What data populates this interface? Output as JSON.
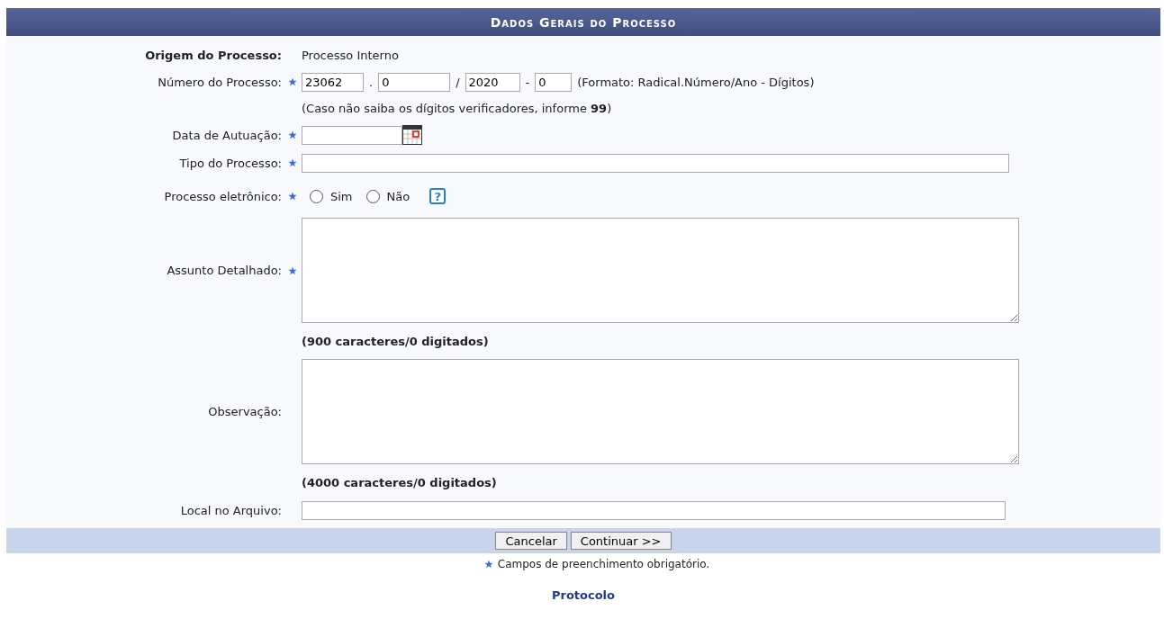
{
  "header": {
    "title": "Dados Gerais do Processo"
  },
  "fields": [
    {
      "kind": "static",
      "label": "Origem do Processo:",
      "required": false,
      "value": "Processo Interno"
    },
    {
      "kind": "process_number",
      "label": "Número do Processo:",
      "required": true,
      "parts": [
        {
          "value": "23062"
        },
        {
          "separator": ".",
          "value": "0"
        },
        {
          "separator": "/",
          "value": "2020"
        },
        {
          "separator": "-",
          "value": "0"
        }
      ],
      "format": "(Formato: Radical.Número/Ano - Dígitos)"
    },
    {
      "kind": "note",
      "text": "(Caso não saiba os dígitos verificadores, informe **99**)"
    },
    {
      "kind": "date",
      "label": "Data de Autuação:",
      "required": true
    },
    {
      "kind": "text",
      "label": "Tipo do Processo:",
      "required": true
    },
    {
      "kind": "radio",
      "label": "Processo eletrônico:",
      "required": true,
      "options": [
        {
          "label": "Sim",
          "selected": false
        },
        {
          "label": "Não",
          "selected": false
        }
      ],
      "help": "?"
    },
    {
      "kind": "textarea",
      "label": "Assunto Detalhado:",
      "required": true,
      "counter": "(900 caracteres/0 digitados)"
    },
    {
      "kind": "textarea",
      "label": "Observação:",
      "required": false,
      "counter": "(4000 caracteres/0 digitados)"
    },
    {
      "kind": "text_short",
      "label": "Local no Arquivo:",
      "required": false
    }
  ],
  "buttons": [
    "Cancelar",
    "Continuar >>"
  ],
  "required_note": "Campos de preenchimento obrigatório.",
  "footer_link": "Protocolo"
}
